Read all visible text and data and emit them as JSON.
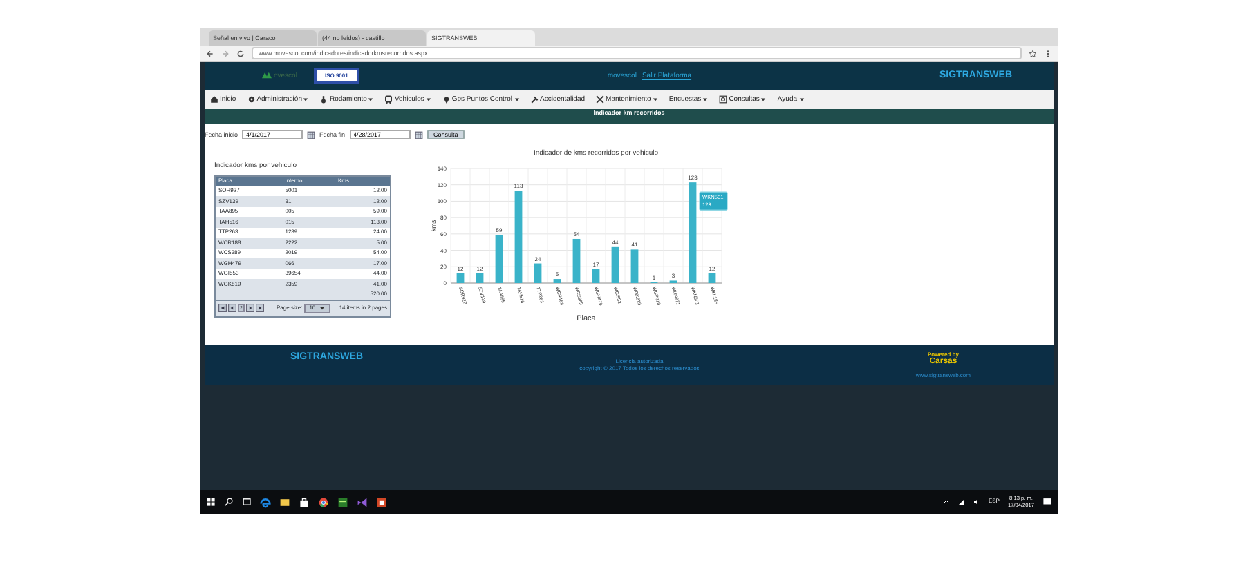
{
  "browser": {
    "tabs": [
      {
        "label": "Señal en vivo | Caraco",
        "selected": false
      },
      {
        "label": "(44 no leídos) - castillo_",
        "selected": false
      },
      {
        "label": "SIGTRANSWEB",
        "selected": true
      }
    ],
    "url": "www.movescol.com/indicadores/indicadorkmsrecorridos.aspx"
  },
  "header": {
    "logo": "ovescol",
    "badge": "ISO 9001",
    "user": "movescol",
    "logout": "Salir Plataforma",
    "brand": "SIGTRANSWEB"
  },
  "menu": [
    {
      "label": "Inicio",
      "caret": false
    },
    {
      "label": "Administración",
      "caret": true
    },
    {
      "label": "Rodamiento",
      "caret": true
    },
    {
      "label": "Vehiculos",
      "caret": true
    },
    {
      "label": "Gps Puntos Control",
      "caret": true
    },
    {
      "label": "Accidentalidad",
      "caret": false
    },
    {
      "label": "Mantenimiento",
      "caret": true
    },
    {
      "label": "Encuestas",
      "caret": true
    },
    {
      "label": "Consultas",
      "caret": true
    },
    {
      "label": "Ayuda",
      "caret": true
    }
  ],
  "page_title": "Indicador km recorridos",
  "filter": {
    "start_label": "Fecha inicio",
    "start": "4/1/2017",
    "end_label": "Fecha fin",
    "end": "4/28/2017",
    "button": "Consulta"
  },
  "table": {
    "title": "Indicador kms por vehiculo",
    "columns": [
      "Placa",
      "Interno",
      "Kms"
    ],
    "rows": [
      [
        "SOR927",
        "5001",
        "12.00"
      ],
      [
        "SZV139",
        "31",
        "12.00"
      ],
      [
        "TAA895",
        "005",
        "59.00"
      ],
      [
        "TAH516",
        "015",
        "113.00"
      ],
      [
        "TTP263",
        "1239",
        "24.00"
      ],
      [
        "WCR188",
        "2222",
        "5.00"
      ],
      [
        "WCS389",
        "2019",
        "54.00"
      ],
      [
        "WGH479",
        "066",
        "17.00"
      ],
      [
        "WGI553",
        "39654",
        "44.00"
      ],
      [
        "WGK819",
        "2359",
        "41.00"
      ]
    ],
    "total": "520.00",
    "pager": {
      "page": "2",
      "page_size_label": "Page size:",
      "page_size": "10",
      "items": "14",
      "items_text": "items in 2 pages"
    }
  },
  "chart": {
    "tooltip": {
      "title": "WKN501",
      "value": "123"
    },
    "chart_data": {
      "type": "bar",
      "title": "Indicador de kms recorridos por vehiculo",
      "xlabel": "Placa",
      "ylabel": "kms",
      "categories": [
        "SOR927",
        "SZV139",
        "TAA895",
        "TAH516",
        "TTP263",
        "WCR188",
        "WCS389",
        "WGH479",
        "WGI553",
        "WGK819",
        "WGP710",
        "WHN971",
        "WKN501",
        "WKL185"
      ],
      "values": [
        12,
        12,
        59,
        113,
        24,
        5,
        54,
        17,
        44,
        41,
        1,
        3,
        123,
        12
      ],
      "ylim": [
        0,
        140
      ],
      "yticks": [
        0,
        20,
        40,
        60,
        80,
        100,
        120,
        140
      ],
      "data_labels": true,
      "grid": true
    }
  },
  "footer": {
    "brand": "SIGTRANSWEB",
    "license": "Licencia autorizada",
    "copyright": "copyright © 2017 Todos los derechos reservados",
    "powered": "Powered by",
    "company": "Carsas",
    "site": "www.sigtransweb.com"
  },
  "taskbar": {
    "lang": "ESP",
    "time": "8:13 p. m.",
    "date": "17/04/2017"
  }
}
